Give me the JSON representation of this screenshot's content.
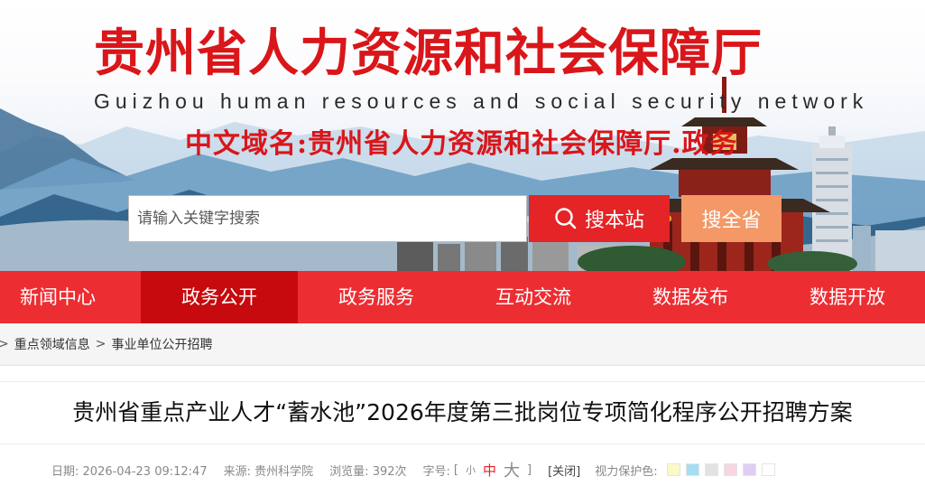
{
  "banner": {
    "title": "贵州省人力资源和社会保障厅",
    "subtitle": "Guizhou human resources and social security network",
    "domain": "中文域名:贵州省人力资源和社会保障厅.政务"
  },
  "search": {
    "placeholder": "请输入关键字搜索",
    "value": "",
    "site_button": "搜本站",
    "province_button": "搜全省"
  },
  "nav": {
    "items": [
      {
        "label": "新闻中心"
      },
      {
        "label": "政务公开",
        "active": true
      },
      {
        "label": "政务服务"
      },
      {
        "label": "互动交流"
      },
      {
        "label": "数据发布"
      },
      {
        "label": "数据开放"
      }
    ]
  },
  "breadcrumb": {
    "lead": ">",
    "items": [
      "重点领域信息",
      "事业单位公开招聘"
    ],
    "separator": ">"
  },
  "article": {
    "title": "贵州省重点产业人才“蓄水池”2026年度第三批岗位专项简化程序公开招聘方案",
    "date_label": "日期:",
    "date": "2026-04-23 09:12:47",
    "source_label": "来源:",
    "source": "贵州科学院",
    "views_label": "浏览量:",
    "views": "392次",
    "font_size_label": "字号:",
    "font_sizes": {
      "bracket_open": "[",
      "small": "小",
      "medium": "中",
      "large": "大",
      "bracket_close": "]"
    },
    "close_label": "[关闭]",
    "eye_care_label": "视力保护色:",
    "eye_care_colors": [
      "#faf9c8",
      "#a6ddf3",
      "#e2e2e2",
      "#f7d6e0",
      "#e0cdf5",
      "#ffffff"
    ]
  },
  "colors": {
    "nav_bg": "#ec2e33",
    "nav_active": "#c60a0d",
    "title_red": "#d9161a",
    "search_site": "#e42426",
    "search_province": "#f39866"
  }
}
